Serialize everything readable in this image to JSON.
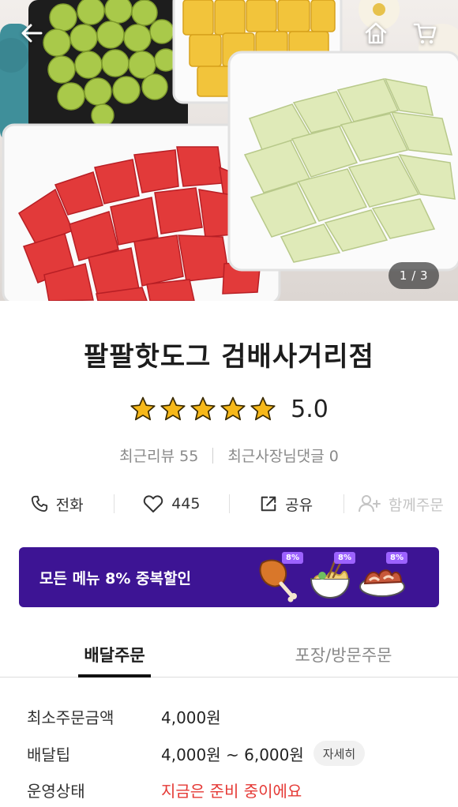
{
  "header": {
    "back_icon": "arrow-left-icon",
    "home_icon": "home-icon",
    "cart_icon": "cart-icon",
    "image_counter": "1 / 3"
  },
  "store": {
    "name": "팔팔핫도그 검배사거리점",
    "rating": 5.0,
    "rating_text": "5.0",
    "stars_filled": 5,
    "star_color": "#f6b81a",
    "recent_reviews_label": "최근리뷰 55",
    "recent_owner_comments_label": "최근사장님댓글 0"
  },
  "actions": [
    {
      "icon": "phone-icon",
      "label": "전화",
      "enabled": true
    },
    {
      "icon": "heart-icon",
      "label": "445",
      "enabled": true
    },
    {
      "icon": "share-icon",
      "label": "공유",
      "enabled": true
    },
    {
      "icon": "group-order-icon",
      "label": "함께주문",
      "enabled": false
    }
  ],
  "promo": {
    "text": "모든 메뉴 8% 중복할인",
    "background_color": "#3d1494",
    "badges": [
      "8%",
      "8%",
      "8%"
    ]
  },
  "tabs": [
    {
      "label": "배달주문",
      "active": true
    },
    {
      "label": "포장/방문주문",
      "active": false
    }
  ],
  "info": {
    "min_order_label": "최소주문금액",
    "min_order_value": "4,000원",
    "delivery_tip_label": "배달팁",
    "delivery_tip_value": "4,000원 ~ 6,000원",
    "delivery_tip_detail": "자세히",
    "status_label": "운영상태",
    "status_value": "지금은 준비 중이에요",
    "status_color": "#e53935"
  }
}
